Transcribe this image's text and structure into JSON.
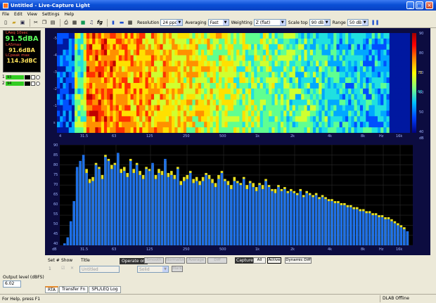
{
  "window": {
    "title": "Untitled - Live-Capture Light"
  },
  "menu": [
    "File",
    "Edit",
    "View",
    "Settings",
    "Help"
  ],
  "toolbar": {
    "icons": [
      "new-icon",
      "open-icon",
      "save-icon",
      "cut-icon",
      "copy-icon",
      "paste-icon",
      "print-icon",
      "printer-icon",
      "record-icon",
      "bell-icon",
      "fg-icon",
      "bars-icon",
      "spectrogram-icon",
      "grid-icon"
    ],
    "fg_label": "fg",
    "resolution_label": "Resolution",
    "resolution_value": "24 ppo",
    "averaging_label": "Averaging",
    "averaging_value": "Fast",
    "weighting_label": "Weighting",
    "weighting_value": "Z (flat)",
    "scaletop_label": "Scale top",
    "scaletop_value": "90 dB",
    "range_label": "Range",
    "range_value": "50 dB"
  },
  "meters": [
    {
      "label": "LAeq 10sec",
      "value": "91.5dBA"
    },
    {
      "label": "LASmax",
      "value": "91.6dBA"
    },
    {
      "label": "LCpeak max",
      "value": "114.3dBC"
    }
  ],
  "channels": [
    {
      "num": "1",
      "level": "93"
    },
    {
      "num": "2",
      "level": "94"
    }
  ],
  "output": {
    "label": "Output level (dBFS)",
    "value": "6.02"
  },
  "spectrogram": {
    "y_ticks": [
      "-5",
      "-4",
      "-3",
      "-2",
      "-1",
      "s"
    ],
    "x_ticks": [
      "31.5",
      "63",
      "125",
      "250",
      "500",
      "1k",
      "2k",
      "4k",
      "8k",
      "Hz",
      "16k"
    ],
    "x_first": "4",
    "colorbar_ticks": [
      "90",
      "80",
      "70",
      "60",
      "50",
      "40"
    ],
    "colorbar_unit": "dB",
    "marker_values": [
      "70",
      "60"
    ]
  },
  "chart_data": {
    "type": "bar",
    "title": "",
    "xlabel": "",
    "ylabel": "",
    "y_unit_label": "dB",
    "ylim": [
      40,
      90
    ],
    "y_ticks": [
      "90",
      "85",
      "80",
      "75",
      "70",
      "65",
      "60",
      "55",
      "50",
      "45",
      "40"
    ],
    "x_ticks": [
      "31.5",
      "63",
      "125",
      "250",
      "500",
      "1k",
      "2k",
      "4k",
      "8k",
      "Hz",
      "16k"
    ],
    "grid": true,
    "series": [
      {
        "name": "1",
        "color": "#1e6fe8",
        "values": [
          41,
          44,
          52,
          62,
          79,
          82,
          85,
          76,
          71,
          72,
          80,
          78,
          73,
          84,
          82,
          78,
          80,
          86,
          76,
          77,
          74,
          82,
          76,
          80,
          75,
          73,
          78,
          77,
          81,
          73,
          76,
          75,
          83,
          74,
          75,
          73,
          78,
          70,
          72,
          73,
          76,
          71,
          72,
          70,
          72,
          75,
          73,
          71,
          69,
          73,
          76,
          72,
          70,
          68,
          72,
          71,
          70,
          73,
          68,
          71,
          69,
          67,
          70,
          68,
          72,
          69,
          67,
          66,
          69,
          67,
          68,
          66,
          67,
          66,
          65,
          67,
          64,
          66,
          65,
          64,
          65,
          63,
          64,
          63,
          62,
          62,
          61,
          61,
          60,
          60,
          59,
          59,
          58,
          58,
          57,
          57,
          56,
          56,
          55,
          55,
          54,
          54,
          53,
          53,
          52,
          51,
          50,
          49,
          48,
          47
        ]
      },
      {
        "name": "2",
        "color": "#e8e020",
        "values": [
          40,
          43,
          50,
          60,
          77,
          80,
          83,
          78,
          73,
          74,
          81,
          79,
          75,
          85,
          83,
          80,
          81,
          85,
          78,
          79,
          76,
          83,
          78,
          81,
          77,
          75,
          79,
          78,
          80,
          75,
          78,
          77,
          82,
          76,
          77,
          75,
          79,
          72,
          74,
          75,
          77,
          73,
          74,
          72,
          74,
          76,
          75,
          73,
          71,
          75,
          77,
          73,
          72,
          70,
          74,
          72,
          71,
          74,
          70,
          72,
          71,
          69,
          71,
          70,
          73,
          70,
          68,
          68,
          70,
          68,
          69,
          67,
          68,
          67,
          66,
          68,
          65,
          67,
          66,
          65,
          66,
          64,
          65,
          64,
          63,
          63,
          62,
          62,
          61,
          61,
          60,
          60,
          59,
          59,
          58,
          58,
          57,
          57,
          56,
          56,
          55,
          55,
          54,
          54,
          53,
          52,
          51,
          50,
          49,
          47
        ]
      }
    ]
  },
  "controls": {
    "set_label": "Set #",
    "show_label": "Show",
    "title_label": "Title",
    "operate_label": "Operate on",
    "smooth": "Smooth",
    "normalize": "Normalize",
    "average": "Average",
    "diff": "Diff",
    "capture_label": "Capture",
    "all": "All",
    "active": "Active",
    "dynamic_diff": "Dynamic Diff",
    "row_num": "1",
    "row_title": "Untitled",
    "row_line": "Solid",
    "row_btn": "Mark"
  },
  "tabs": [
    "RTA",
    "Transfer Fn",
    "SPL/LEQ Log"
  ],
  "status": {
    "help": "For Help, press F1",
    "state": "DLAB Offline"
  }
}
